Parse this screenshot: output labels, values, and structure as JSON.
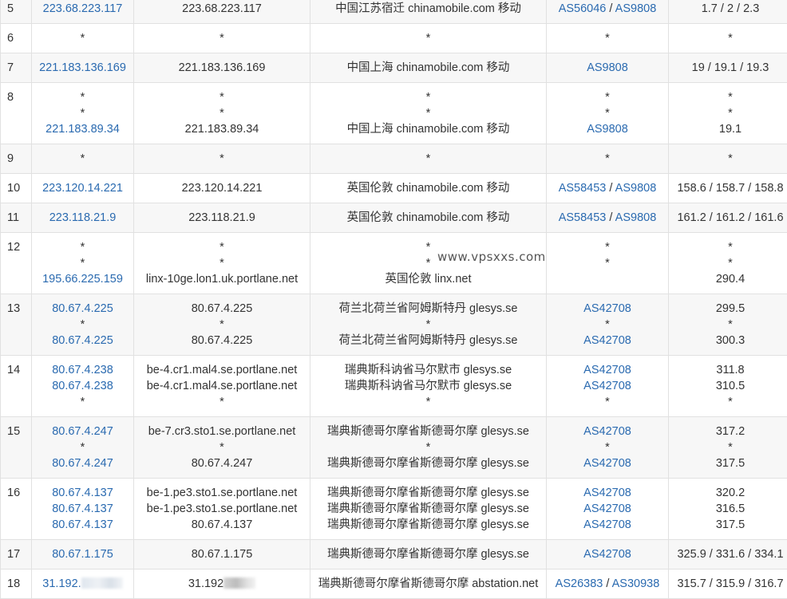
{
  "watermark": "www.vpsxxs.com",
  "rows": [
    {
      "hop": "5",
      "ip": [
        {
          "type": "link",
          "text": "223.68.223.117"
        }
      ],
      "host": [
        "223.68.223.117"
      ],
      "loc": [
        "中国江苏宿迁 chinamobile.com 移动"
      ],
      "asn": [
        [
          "AS56046",
          "AS9808"
        ]
      ],
      "time": [
        "1.7 / 2 / 2.3"
      ]
    },
    {
      "hop": "6",
      "ip": [
        {
          "type": "text",
          "text": "*"
        }
      ],
      "host": [
        "*"
      ],
      "loc": [
        "*"
      ],
      "asn": [
        "*"
      ],
      "time": [
        "*"
      ]
    },
    {
      "hop": "7",
      "ip": [
        {
          "type": "link",
          "text": "221.183.136.169"
        }
      ],
      "host": [
        "221.183.136.169"
      ],
      "loc": [
        "中国上海 chinamobile.com 移动"
      ],
      "asn": [
        [
          "AS9808"
        ]
      ],
      "time": [
        "19 / 19.1 / 19.3"
      ]
    },
    {
      "hop": "8",
      "ip": [
        {
          "type": "text",
          "text": "*"
        },
        {
          "type": "text",
          "text": "*"
        },
        {
          "type": "link",
          "text": "221.183.89.34"
        }
      ],
      "host": [
        "*",
        "*",
        "221.183.89.34"
      ],
      "loc": [
        "*",
        "*",
        "中国上海 chinamobile.com 移动"
      ],
      "asn": [
        "*",
        "*",
        [
          "AS9808"
        ]
      ],
      "time": [
        "*",
        "*",
        "19.1"
      ]
    },
    {
      "hop": "9",
      "ip": [
        {
          "type": "text",
          "text": "*"
        }
      ],
      "host": [
        "*"
      ],
      "loc": [
        "*"
      ],
      "asn": [
        "*"
      ],
      "time": [
        "*"
      ]
    },
    {
      "hop": "10",
      "ip": [
        {
          "type": "link",
          "text": "223.120.14.221"
        }
      ],
      "host": [
        "223.120.14.221"
      ],
      "loc": [
        "英国伦敦 chinamobile.com 移动"
      ],
      "asn": [
        [
          "AS58453",
          "AS9808"
        ]
      ],
      "time": [
        "158.6 / 158.7 / 158.8"
      ]
    },
    {
      "hop": "11",
      "ip": [
        {
          "type": "link",
          "text": "223.118.21.9"
        }
      ],
      "host": [
        "223.118.21.9"
      ],
      "loc": [
        "英国伦敦 chinamobile.com 移动"
      ],
      "asn": [
        [
          "AS58453",
          "AS9808"
        ]
      ],
      "time": [
        "161.2 / 161.2 / 161.6"
      ]
    },
    {
      "hop": "12",
      "ip": [
        {
          "type": "text",
          "text": "*"
        },
        {
          "type": "text",
          "text": "*"
        },
        {
          "type": "link",
          "text": "195.66.225.159"
        }
      ],
      "host": [
        "*",
        "*",
        "linx-10ge.lon1.uk.portlane.net"
      ],
      "loc": [
        "*",
        "*",
        "英国伦敦 linx.net"
      ],
      "asn": [
        "*",
        "*",
        ""
      ],
      "time": [
        "*",
        "*",
        "290.4"
      ]
    },
    {
      "hop": "13",
      "ip": [
        {
          "type": "link",
          "text": "80.67.4.225"
        },
        {
          "type": "text",
          "text": "*"
        },
        {
          "type": "link",
          "text": "80.67.4.225"
        }
      ],
      "host": [
        "80.67.4.225",
        "*",
        "80.67.4.225"
      ],
      "loc": [
        "荷兰北荷兰省阿姆斯特丹 glesys.se",
        "*",
        "荷兰北荷兰省阿姆斯特丹 glesys.se"
      ],
      "asn": [
        [
          "AS42708"
        ],
        "*",
        [
          "AS42708"
        ]
      ],
      "time": [
        "299.5",
        "*",
        "300.3"
      ]
    },
    {
      "hop": "14",
      "ip": [
        {
          "type": "link",
          "text": "80.67.4.238"
        },
        {
          "type": "link",
          "text": "80.67.4.238"
        },
        {
          "type": "text",
          "text": "*"
        }
      ],
      "host": [
        "be-4.cr1.mal4.se.portlane.net",
        "be-4.cr1.mal4.se.portlane.net",
        "*"
      ],
      "loc": [
        "瑞典斯科讷省马尔默市 glesys.se",
        "瑞典斯科讷省马尔默市 glesys.se",
        "*"
      ],
      "asn": [
        [
          "AS42708"
        ],
        [
          "AS42708"
        ],
        "*"
      ],
      "time": [
        "311.8",
        "310.5",
        "*"
      ]
    },
    {
      "hop": "15",
      "ip": [
        {
          "type": "link",
          "text": "80.67.4.247"
        },
        {
          "type": "text",
          "text": "*"
        },
        {
          "type": "link",
          "text": "80.67.4.247"
        }
      ],
      "host": [
        "be-7.cr3.sto1.se.portlane.net",
        "*",
        "80.67.4.247"
      ],
      "loc": [
        "瑞典斯德哥尔摩省斯德哥尔摩 glesys.se",
        "*",
        "瑞典斯德哥尔摩省斯德哥尔摩 glesys.se"
      ],
      "asn": [
        [
          "AS42708"
        ],
        "*",
        [
          "AS42708"
        ]
      ],
      "time": [
        "317.2",
        "*",
        "317.5"
      ]
    },
    {
      "hop": "16",
      "ip": [
        {
          "type": "link",
          "text": "80.67.4.137"
        },
        {
          "type": "link",
          "text": "80.67.4.137"
        },
        {
          "type": "link",
          "text": "80.67.4.137"
        }
      ],
      "host": [
        "be-1.pe3.sto1.se.portlane.net",
        "be-1.pe3.sto1.se.portlane.net",
        "80.67.4.137"
      ],
      "loc": [
        "瑞典斯德哥尔摩省斯德哥尔摩 glesys.se",
        "瑞典斯德哥尔摩省斯德哥尔摩 glesys.se",
        "瑞典斯德哥尔摩省斯德哥尔摩 glesys.se"
      ],
      "asn": [
        [
          "AS42708"
        ],
        [
          "AS42708"
        ],
        [
          "AS42708"
        ]
      ],
      "time": [
        "320.2",
        "316.5",
        "317.5"
      ]
    },
    {
      "hop": "17",
      "ip": [
        {
          "type": "link",
          "text": "80.67.1.175"
        }
      ],
      "host": [
        "80.67.1.175"
      ],
      "loc": [
        "瑞典斯德哥尔摩省斯德哥尔摩 glesys.se"
      ],
      "asn": [
        [
          "AS42708"
        ]
      ],
      "time": [
        "325.9 / 331.6 / 334.1"
      ]
    },
    {
      "hop": "18",
      "ip": [
        {
          "type": "link",
          "text": "31.192.",
          "redacted": true
        }
      ],
      "host": [
        {
          "text": "31.192",
          "redacted": true
        }
      ],
      "loc": [
        "瑞典斯德哥尔摩省斯德哥尔摩 abstation.net"
      ],
      "asn": [
        [
          "AS26383",
          "AS30938"
        ]
      ],
      "time": [
        "315.7 / 315.9 / 316.7"
      ]
    }
  ]
}
